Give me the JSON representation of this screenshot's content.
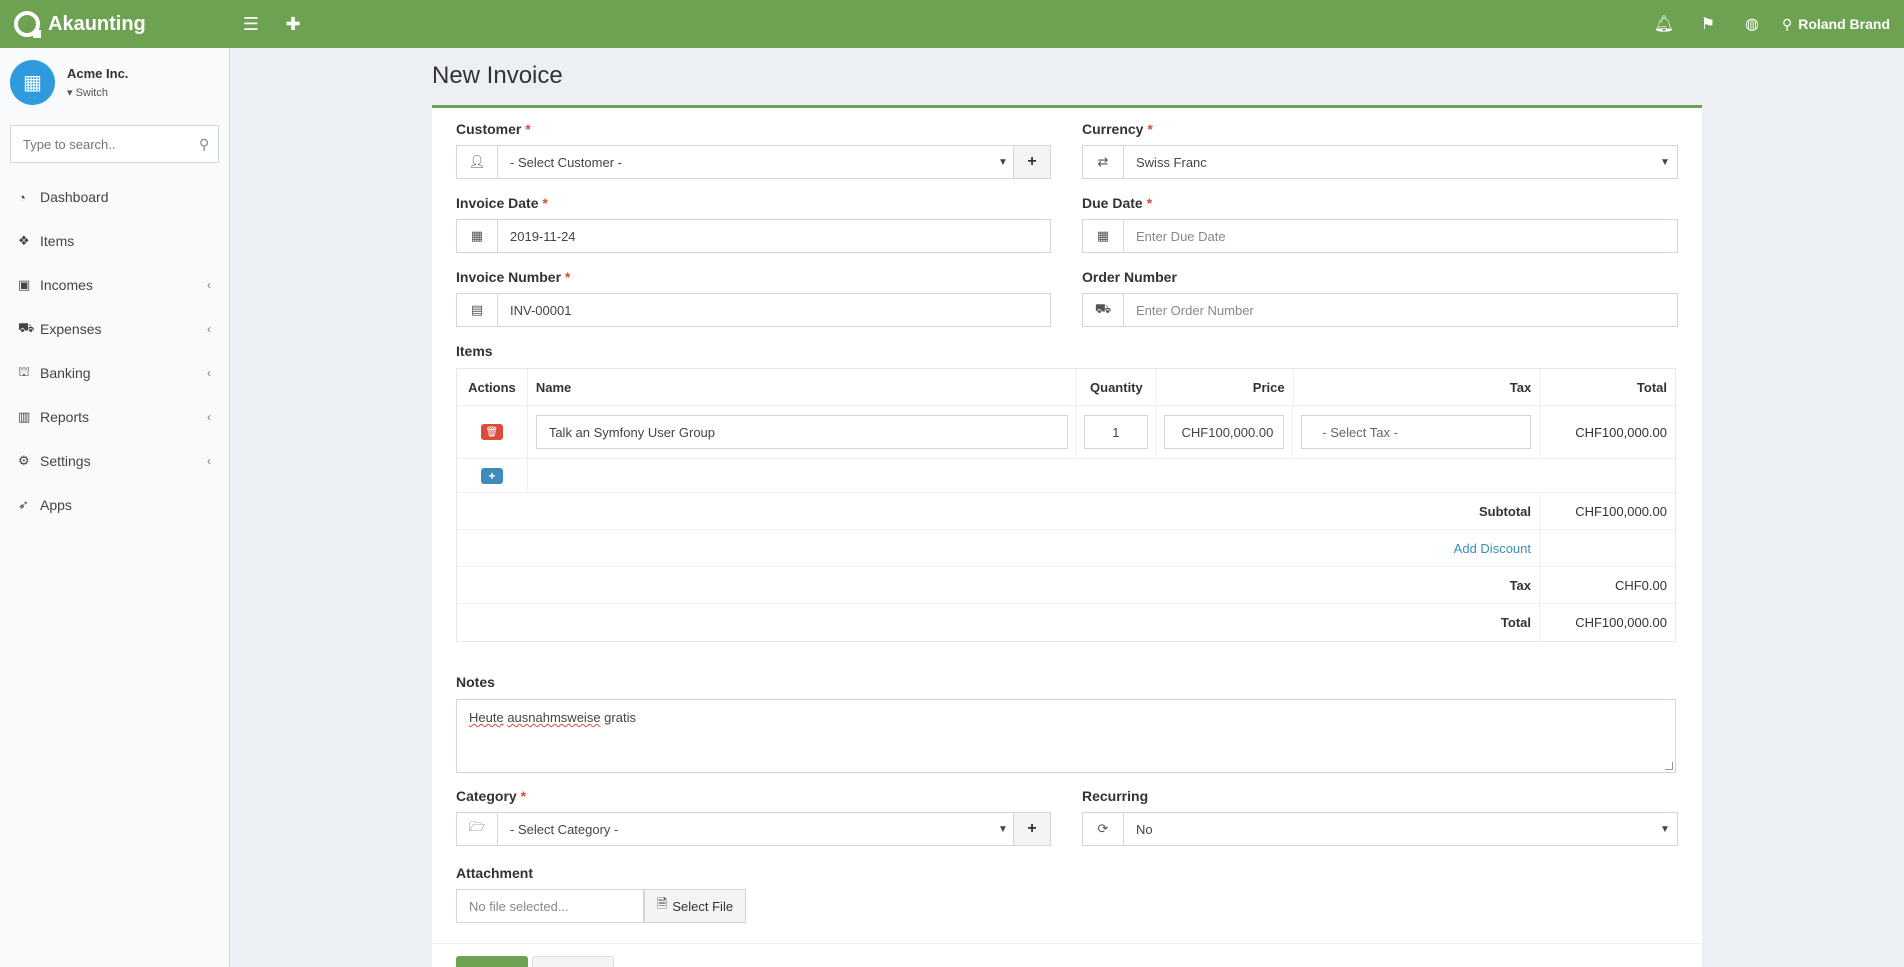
{
  "app": {
    "brand": "Akaunting",
    "user": "Roland Brand"
  },
  "header": {
    "menu_icon": "bars-icon",
    "add_icon": "plus-icon",
    "icons": [
      "bell-icon",
      "flag-icon",
      "globe-icon",
      "user-icon"
    ]
  },
  "company": {
    "name": "Acme Inc.",
    "switch_label": "Switch"
  },
  "search": {
    "placeholder": "Type to search.."
  },
  "sidebar": {
    "items": [
      {
        "label": "Dashboard",
        "icon": "dashboard-icon",
        "has_children": false
      },
      {
        "label": "Items",
        "icon": "cubes-icon",
        "has_children": false
      },
      {
        "label": "Incomes",
        "icon": "money-icon",
        "has_children": true
      },
      {
        "label": "Expenses",
        "icon": "cart-icon",
        "has_children": true
      },
      {
        "label": "Banking",
        "icon": "bank-icon",
        "has_children": true
      },
      {
        "label": "Reports",
        "icon": "bar-chart-icon",
        "has_children": true
      },
      {
        "label": "Settings",
        "icon": "gears-icon",
        "has_children": true
      },
      {
        "label": "Apps",
        "icon": "rocket-icon",
        "has_children": false
      }
    ]
  },
  "page": {
    "title": "New Invoice"
  },
  "form": {
    "customer": {
      "label": "Customer",
      "value": "- Select Customer -"
    },
    "currency": {
      "label": "Currency",
      "value": "Swiss Franc"
    },
    "invoice_date": {
      "label": "Invoice Date",
      "value": "2019-11-24"
    },
    "due_date": {
      "label": "Due Date",
      "placeholder": "Enter Due Date"
    },
    "invoice_number": {
      "label": "Invoice Number",
      "value": "INV-00001"
    },
    "order_number": {
      "label": "Order Number",
      "placeholder": "Enter Order Number"
    },
    "items_label": "Items",
    "items_headers": {
      "actions": "Actions",
      "name": "Name",
      "quantity": "Quantity",
      "price": "Price",
      "tax": "Tax",
      "total": "Total"
    },
    "items": [
      {
        "name": "Talk an Symfony User Group",
        "quantity": "1",
        "price": "CHF100,000.00",
        "tax": "- Select Tax -",
        "total": "CHF100,000.00"
      }
    ],
    "totals": {
      "subtotal_label": "Subtotal",
      "subtotal": "CHF100,000.00",
      "discount_link": "Add Discount",
      "tax_label": "Tax",
      "tax": "CHF0.00",
      "total_label": "Total",
      "total": "CHF100,000.00"
    },
    "notes": {
      "label": "Notes",
      "word1": "Heute",
      "word2": "ausnahmsweise",
      "word3": "gratis"
    },
    "category": {
      "label": "Category",
      "value": "- Select Category -"
    },
    "recurring": {
      "label": "Recurring",
      "value": "No"
    },
    "attachment": {
      "label": "Attachment",
      "placeholder": "No file selected...",
      "button": "Select File"
    }
  }
}
